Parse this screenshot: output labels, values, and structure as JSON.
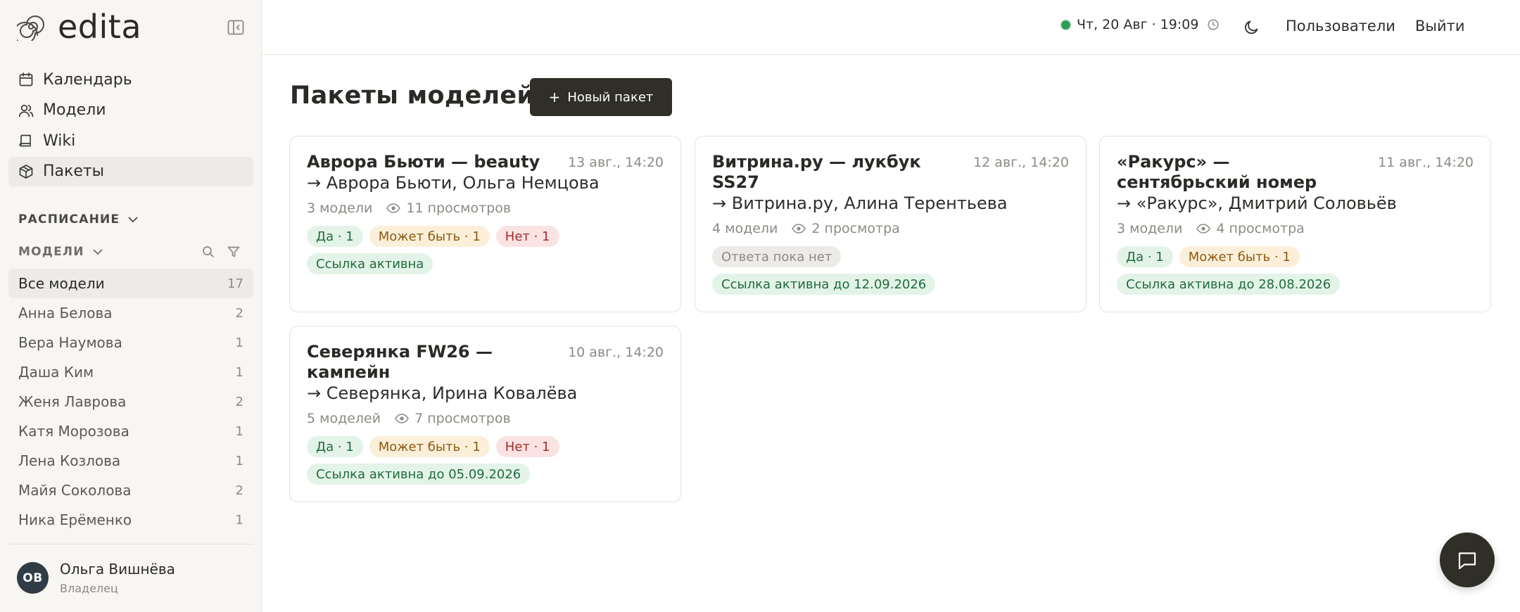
{
  "app": {
    "name": "edita"
  },
  "nav": [
    {
      "label": "Календарь",
      "icon": "calendar-icon"
    },
    {
      "label": "Модели",
      "icon": "users-icon"
    },
    {
      "label": "Wiki",
      "icon": "book-icon"
    },
    {
      "label": "Пакеты",
      "icon": "package-icon",
      "active": true
    }
  ],
  "sections": {
    "schedule": "РАСПИСАНИЕ",
    "models": "МОДЕЛИ"
  },
  "models": [
    {
      "name": "Все модели",
      "count": "17",
      "active": true
    },
    {
      "name": "Анна Белова",
      "count": "2"
    },
    {
      "name": "Вера Наумова",
      "count": "1"
    },
    {
      "name": "Даша Ким",
      "count": "1"
    },
    {
      "name": "Женя Лаврова",
      "count": "2"
    },
    {
      "name": "Катя Морозова",
      "count": "1"
    },
    {
      "name": "Лена Козлова",
      "count": "1"
    },
    {
      "name": "Майя Соколова",
      "count": "2"
    },
    {
      "name": "Ника Ерёменко",
      "count": "1"
    }
  ],
  "user": {
    "initials": "ОВ",
    "name": "Ольга Вишнёва",
    "role": "Владелец"
  },
  "topbar": {
    "datetime": "Чт, 20 Авг · 19:09",
    "users_link": "Пользователи",
    "logout_link": "Выйти"
  },
  "page": {
    "title": "Пакеты моделей",
    "new_button": "Новый пакет",
    "new_button_plus": "+"
  },
  "packages": [
    {
      "title": "Аврора Бьюти — beauty",
      "date": "13 авг., 14:20",
      "client": "→ Аврора Бьюти, Ольга Немцова",
      "models": "3 модели",
      "views": "11 просмотров",
      "chips": [
        {
          "kind": "yes",
          "label": "Да · 1"
        },
        {
          "kind": "maybe",
          "label": "Может быть · 1"
        },
        {
          "kind": "no",
          "label": "Нет · 1"
        }
      ],
      "link": "Ссылка активна"
    },
    {
      "title": "Витрина.ру — лукбук SS27",
      "date": "12 авг., 14:20",
      "client": "→ Витрина.ру, Алина Терентьева",
      "models": "4 модели",
      "views": "2 просмотра",
      "chips": [
        {
          "kind": "none",
          "label": "Ответа пока нет"
        }
      ],
      "link": "Ссылка активна до 12.09.2026"
    },
    {
      "title": "«Ракурс» — сентябрьский номер",
      "date": "11 авг., 14:20",
      "client": "→ «Ракурс», Дмитрий Соловьёв",
      "models": "3 модели",
      "views": "4 просмотра",
      "chips": [
        {
          "kind": "yes",
          "label": "Да · 1"
        },
        {
          "kind": "maybe",
          "label": "Может быть · 1"
        }
      ],
      "link": "Ссылка активна до 28.08.2026"
    },
    {
      "title": "Северянка FW26 — кампейн",
      "date": "10 авг., 14:20",
      "client": "→ Северянка, Ирина Ковалёва",
      "models": "5 моделей",
      "views": "7 просмотров",
      "chips": [
        {
          "kind": "yes",
          "label": "Да · 1"
        },
        {
          "kind": "maybe",
          "label": "Может быть · 1"
        },
        {
          "kind": "no",
          "label": "Нет · 1"
        }
      ],
      "link": "Ссылка активна до 05.09.2026"
    }
  ],
  "colors": {
    "accent_dark": "#2f2e27",
    "status_online": "#2f9e55",
    "yes": "#216b3c",
    "maybe": "#8a5a12",
    "no": "#a32c2c"
  }
}
